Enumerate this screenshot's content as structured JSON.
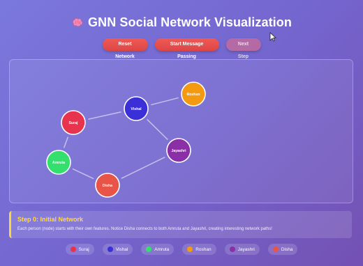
{
  "title": "GNN Social Network Visualization",
  "controls": {
    "reset_label": "Reset Network",
    "start_label": "Start Message Passing",
    "next_label": "Next Step"
  },
  "graph": {
    "nodes": [
      {
        "label": "Suraj",
        "color": "#e8334f"
      },
      {
        "label": "Vishal",
        "color": "#3b2fd8"
      },
      {
        "label": "Roshan",
        "color": "#f39a12"
      },
      {
        "label": "Jayashri",
        "color": "#8a2fa6"
      },
      {
        "label": "Amruta",
        "color": "#33e06e"
      },
      {
        "label": "Disha",
        "color": "#e85448"
      }
    ],
    "edges": [
      [
        "Suraj",
        "Vishal"
      ],
      [
        "Vishal",
        "Roshan"
      ],
      [
        "Vishal",
        "Jayashri"
      ],
      [
        "Suraj",
        "Amruta"
      ],
      [
        "Amruta",
        "Disha"
      ],
      [
        "Disha",
        "Jayashri"
      ]
    ]
  },
  "step": {
    "title": "Step 0: Initial Network",
    "description": "Each person (node) starts with their own features. Notice Disha connects to both Amruta and Jayashri, creating interesting network paths!"
  },
  "legend": [
    {
      "label": "Suraj",
      "color": "#e8334f"
    },
    {
      "label": "Vishal",
      "color": "#3b2fd8"
    },
    {
      "label": "Amruta",
      "color": "#33e06e"
    },
    {
      "label": "Roshan",
      "color": "#f39a12"
    },
    {
      "label": "Jayashri",
      "color": "#8a2fa6"
    },
    {
      "label": "Disha",
      "color": "#e85448"
    }
  ]
}
